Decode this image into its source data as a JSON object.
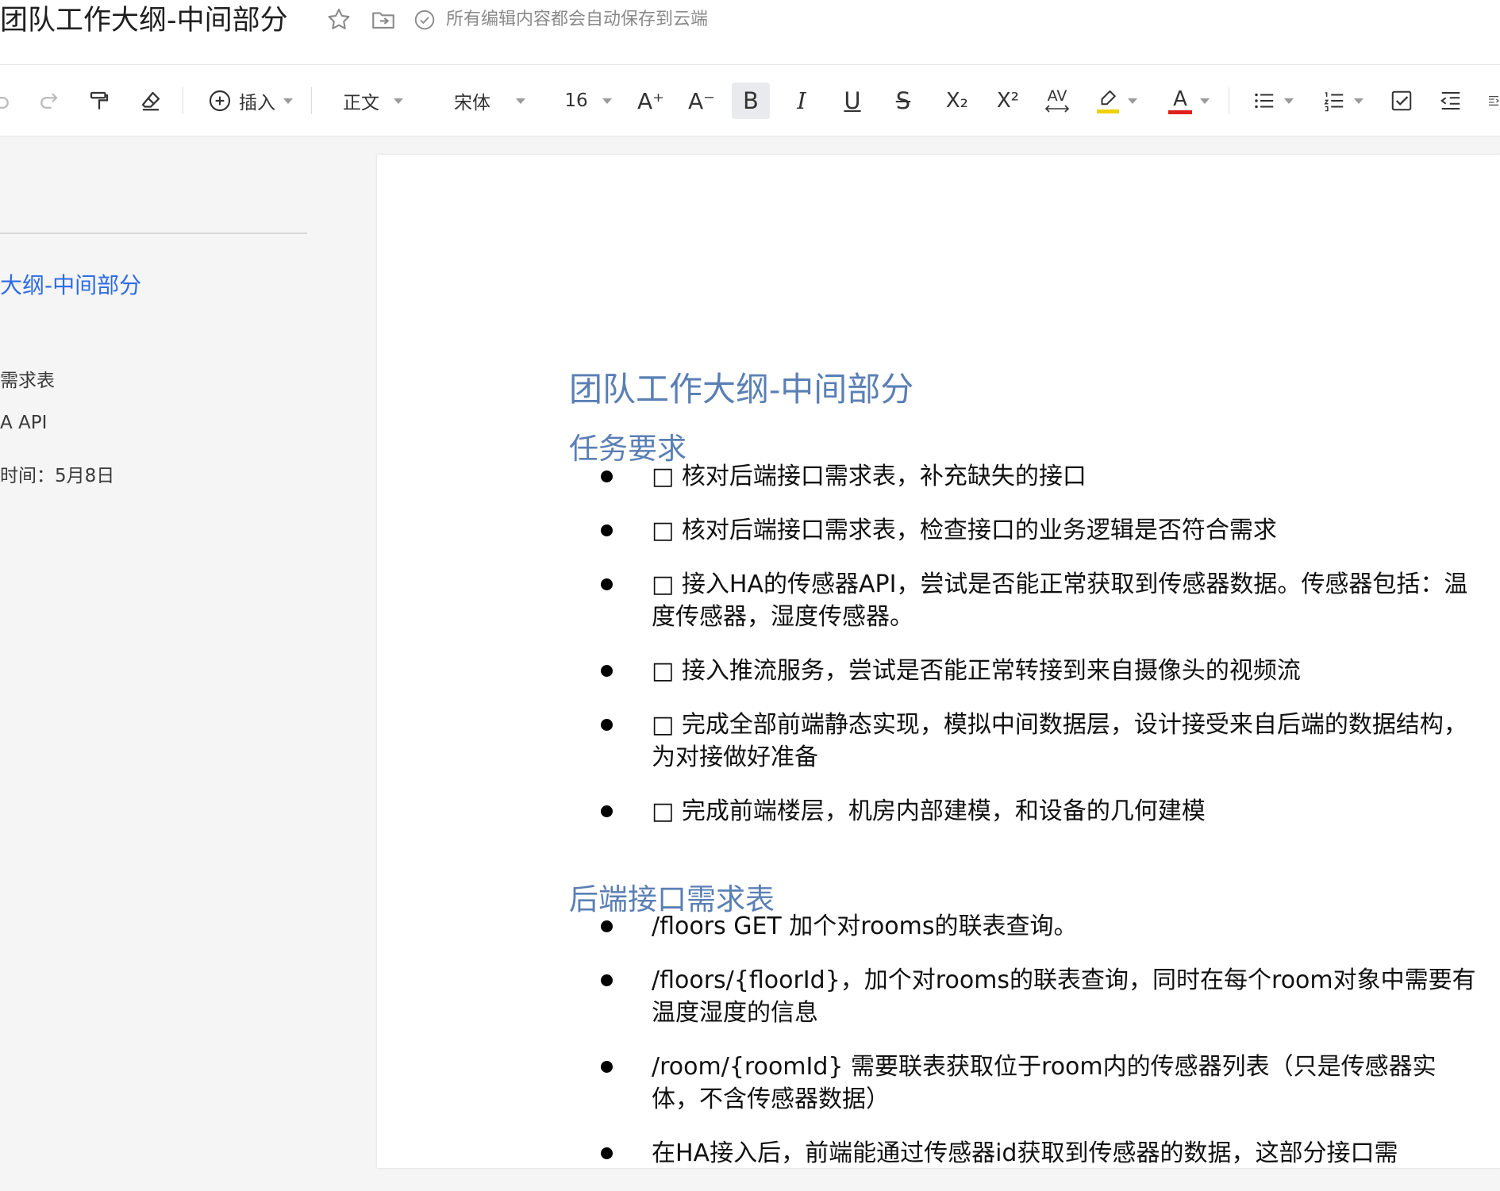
{
  "header": {
    "title": "团队工作大纲-中间部分",
    "save_status": "所有编辑内容都会自动保存到云端"
  },
  "toolbar": {
    "insert_label": "插入",
    "paragraph_style": "正文",
    "font_name": "宋体",
    "font_size": "16",
    "bold_label": "B",
    "italic_label": "I",
    "underline_label": "U",
    "strike_label": "S",
    "subscript_label": "X₂",
    "superscript_label": "X²",
    "spacing_label": "AV",
    "font_color_label": "A",
    "increase_font_label": "A⁺",
    "decrease_font_label": "A⁻",
    "highlight_color": "#f0d000",
    "font_color": "#e0201c"
  },
  "outline": {
    "current": "大纲-中间部分",
    "items": [
      "需求表",
      "A  API",
      "时间：5月8日"
    ]
  },
  "document": {
    "title": "团队工作大纲-中间部分",
    "section1_heading": "任务要求",
    "section1_items": [
      "□ 核对后端接口需求表，补充缺失的接口",
      "□ 核对后端接口需求表，检查接口的业务逻辑是否符合需求",
      "□ 接入HA的传感器API，尝试是否能正常获取到传感器数据。传感器包括：温度传感器，湿度传感器。",
      "□ 接入推流服务，尝试是否能正常转接到来自摄像头的视频流",
      "□ 完成全部前端静态实现，模拟中间数据层，设计接受来自后端的数据结构，为对接做好准备",
      "□ 完成前端楼层，机房内部建模，和设备的几何建模"
    ],
    "section2_heading": "后端接口需求表",
    "section2_items": [
      "/floors GET 加个对rooms的联表查询。",
      "/floors/{floorId}，加个对rooms的联表查询，同时在每个room对象中需要有温度湿度的信息",
      "/room/{roomId} 需要联表获取位于room内的传感器列表（只是传感器实体，不含传感器数据）",
      "在HA接入后，前端能通过传感器id获取到传感器的数据，这部分接口需"
    ]
  }
}
